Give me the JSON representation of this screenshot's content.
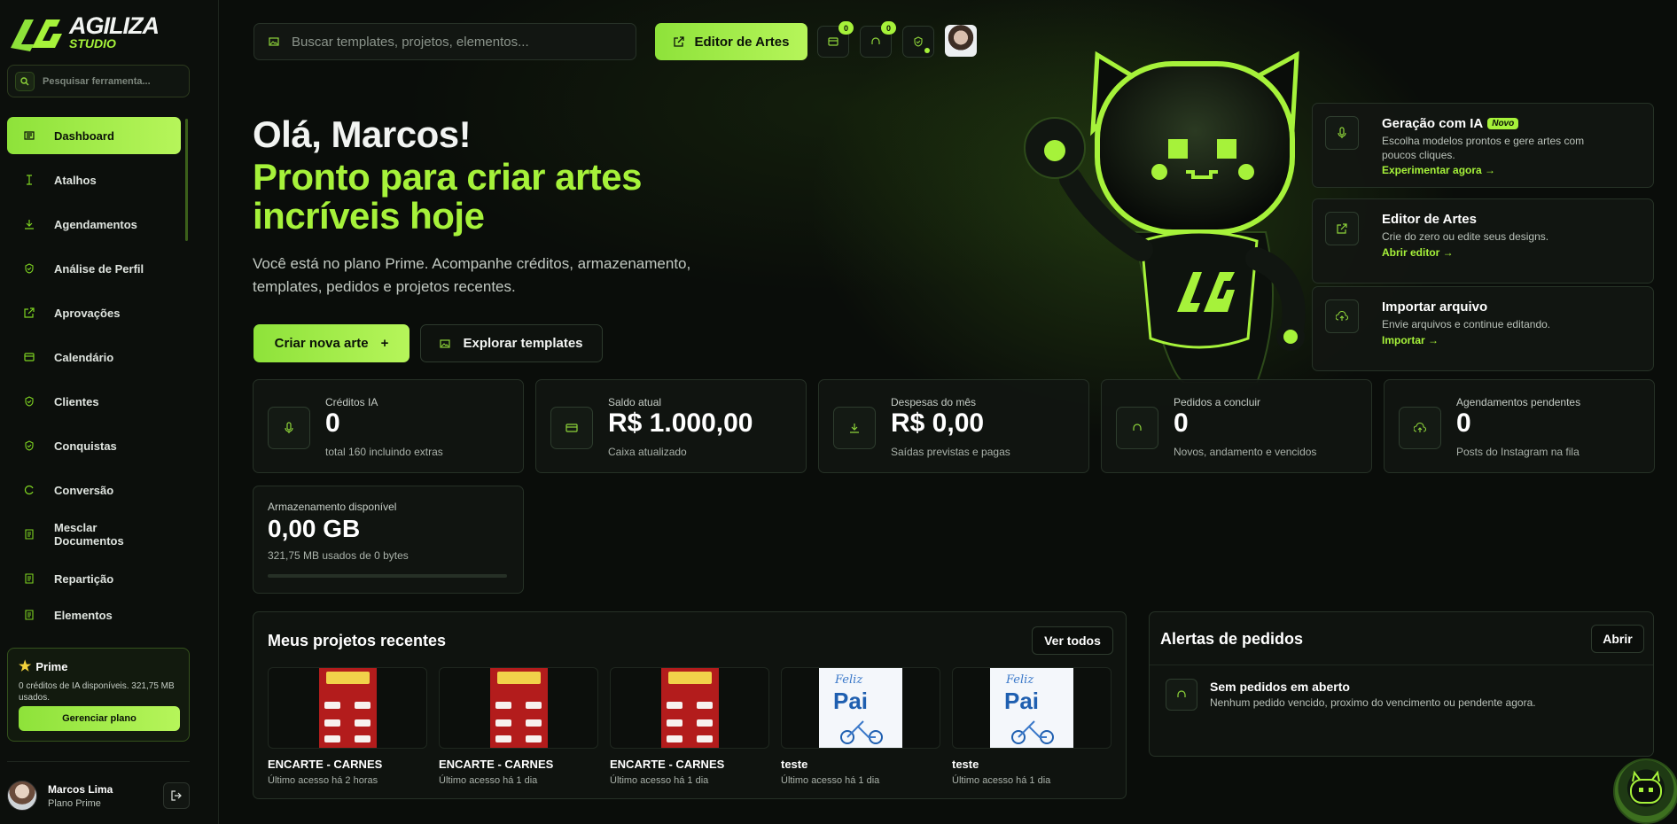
{
  "brand": {
    "name": "AGILIZA",
    "sub": "STUDIO"
  },
  "sidebar": {
    "search_placeholder": "Pesquisar ferramenta...",
    "items": [
      {
        "label": "Dashboard",
        "icon": "dashboard-icon",
        "active": true
      },
      {
        "label": "Atalhos",
        "icon": "text-cursor-icon"
      },
      {
        "label": "Agendamentos",
        "icon": "download-icon"
      },
      {
        "label": "Análise de Perfil",
        "icon": "shield-icon"
      },
      {
        "label": "Aprovações",
        "icon": "external-link-icon"
      },
      {
        "label": "Calendário",
        "icon": "card-icon"
      },
      {
        "label": "Clientes",
        "icon": "shield-icon"
      },
      {
        "label": "Conquistas",
        "icon": "shield-icon"
      },
      {
        "label": "Conversão",
        "icon": "refresh-icon"
      },
      {
        "label": "Mesclar Documentos",
        "icon": "document-icon"
      },
      {
        "label": "Repartição",
        "icon": "document-icon"
      },
      {
        "label": "Elementos",
        "icon": "document-icon"
      }
    ],
    "plan": {
      "title": "Prime",
      "desc": "0 créditos de IA disponíveis. 321,75 MB usados.",
      "button": "Gerenciar plano"
    },
    "user": {
      "name": "Marcos Lima",
      "plan": "Plano Prime"
    }
  },
  "topbar": {
    "search_placeholder": "Buscar templates, projetos, elementos...",
    "editor_button": "Editor de Artes",
    "badge_1": "0",
    "badge_2": "0"
  },
  "hero": {
    "greeting": "Olá, Marcos!",
    "headline": "Pronto para criar artes incríveis hoje",
    "subtitle": "Você está no plano Prime. Acompanhe créditos, armazenamento, templates, pedidos e projetos recentes.",
    "cta_primary": "Criar nova arte",
    "cta_secondary": "Explorar templates"
  },
  "quick_actions": [
    {
      "title": "Geração com IA",
      "tag": "Novo",
      "desc": "Escolha modelos prontos e gere artes com poucos cliques.",
      "link": "Experimentar agora →",
      "icon": "microphone-icon"
    },
    {
      "title": "Editor de Artes",
      "tag": "",
      "desc": "Crie do zero ou edite seus designs.",
      "link": "Abrir editor →",
      "icon": "external-link-icon"
    },
    {
      "title": "Importar arquivo",
      "tag": "",
      "desc": "Envie arquivos e continue editando.",
      "link": "Importar →",
      "icon": "upload-cloud-icon"
    }
  ],
  "stats": [
    {
      "label": "Créditos IA",
      "value": "0",
      "sub": "total 160 incluindo extras",
      "icon": "microphone-icon"
    },
    {
      "label": "Saldo atual",
      "value": "R$ 1.000,00",
      "sub": "Caixa atualizado",
      "icon": "card-icon"
    },
    {
      "label": "Despesas do mês",
      "value": "R$ 0,00",
      "sub": "Saídas previstas e pagas",
      "icon": "download-icon"
    },
    {
      "label": "Pedidos a concluir",
      "value": "0",
      "sub": "Novos, andamento e vencidos",
      "icon": "headset-icon"
    },
    {
      "label": "Agendamentos pendentes",
      "value": "0",
      "sub": "Posts do Instagram na fila",
      "icon": "upload-cloud-icon"
    }
  ],
  "storage": {
    "label": "Armazenamento disponível",
    "value": "0,00 GB",
    "sub": "321,75 MB usados de 0 bytes",
    "fill_fraction": 0
  },
  "projects": {
    "title": "Meus projetos recentes",
    "view_all": "Ver todos",
    "items": [
      {
        "name": "ENCARTE - CARNES",
        "access": "Último acesso há 2 horas",
        "thumb": "meat-flyer"
      },
      {
        "name": "ENCARTE - CARNES",
        "access": "Último acesso há 1 dia",
        "thumb": "meat-flyer"
      },
      {
        "name": "ENCARTE - CARNES",
        "access": "Último acesso há 1 dia",
        "thumb": "meat-flyer"
      },
      {
        "name": "teste",
        "access": "Último acesso há 1 dia",
        "thumb": "fathers-day"
      },
      {
        "name": "teste",
        "access": "Último acesso há 1 dia",
        "thumb": "fathers-day"
      }
    ],
    "thumb_text": {
      "feliz": "Feliz",
      "pai": "Pai"
    }
  },
  "alerts": {
    "title": "Alertas de pedidos",
    "open": "Abrir",
    "empty_title": "Sem pedidos em aberto",
    "empty_desc": "Nenhum pedido vencido, proximo do vencimento ou pendente agora."
  },
  "colors": {
    "accent": "#a6f23a",
    "background": "#0a0d0a",
    "card": "#111511"
  }
}
